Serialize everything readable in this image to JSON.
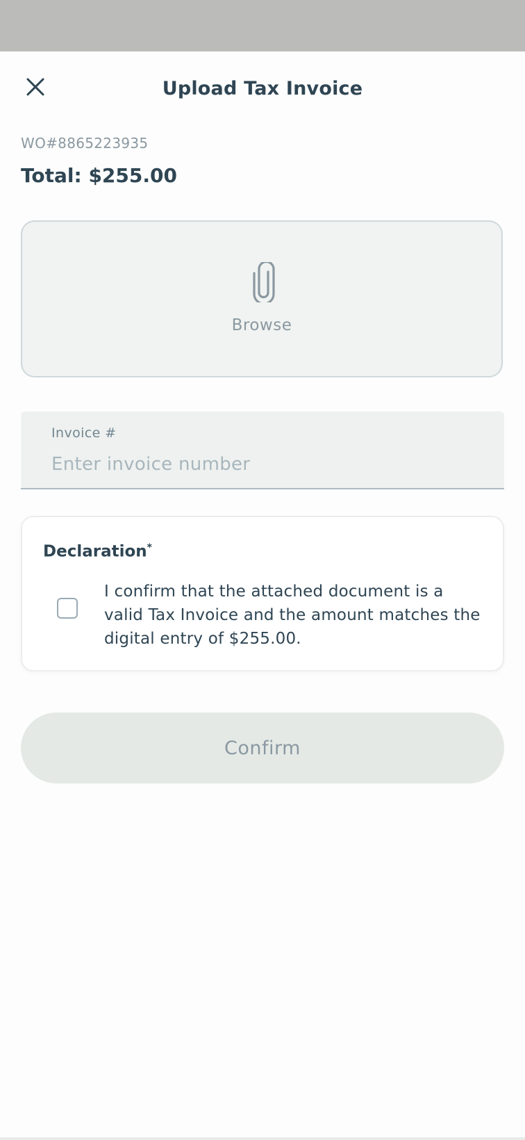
{
  "header": {
    "title": "Upload Tax Invoice",
    "close_icon": "close-icon"
  },
  "order": {
    "wo_number": "WO#8865223935",
    "total": "Total: $255.00"
  },
  "upload": {
    "icon": "paperclip-icon",
    "browse_label": "Browse"
  },
  "invoice": {
    "label": "Invoice #",
    "placeholder": "Enter invoice number",
    "value": ""
  },
  "declaration": {
    "title": "Declaration",
    "required_marker": "*",
    "checked": false,
    "text": "I confirm that the attached document is a valid Tax Invoice and the amount matches the digital entry of $255.00."
  },
  "actions": {
    "confirm_label": "Confirm",
    "confirm_enabled": false
  },
  "colors": {
    "status_bar": "#bbbcba",
    "primary_text": "#2f4553",
    "muted_text": "#8b98a1",
    "disabled_button": "#e4e9e6"
  }
}
